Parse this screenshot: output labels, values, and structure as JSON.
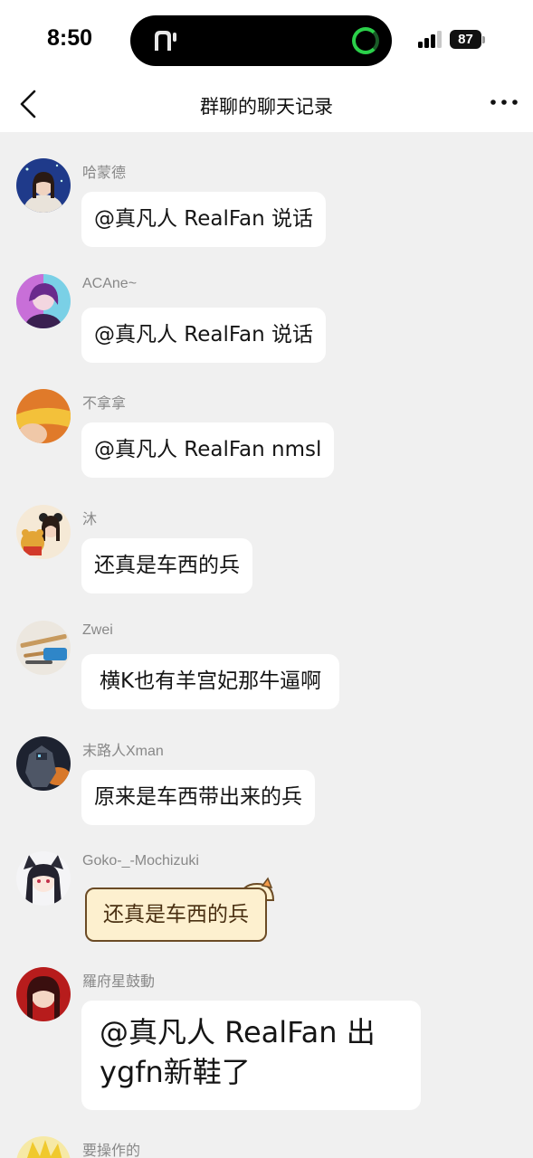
{
  "status": {
    "time": "8:50",
    "battery": "87"
  },
  "nav": {
    "title": "群聊的聊天记录"
  },
  "messages": [
    {
      "sender": "哈蒙德",
      "text": "@真凡人 RealFan 说话"
    },
    {
      "sender": "ACAne~",
      "text": "@真凡人 RealFan 说话"
    },
    {
      "sender": "不拿拿",
      "text": "@真凡人 RealFan nmsl"
    },
    {
      "sender": "沐",
      "text": "还真是车西的兵"
    },
    {
      "sender": "Zwei",
      "text": "横K也有羊宫妃那牛逼啊"
    },
    {
      "sender": "末路人Xman",
      "text": "原来是车西带出来的兵"
    },
    {
      "sender": "Goko-_-Mochizuki",
      "text": "还真是车西的兵"
    },
    {
      "sender": "羅府星鼓動",
      "text": "@真凡人 RealFan 出ygfn新鞋了"
    },
    {
      "sender": "要操作的",
      "text": ""
    }
  ]
}
